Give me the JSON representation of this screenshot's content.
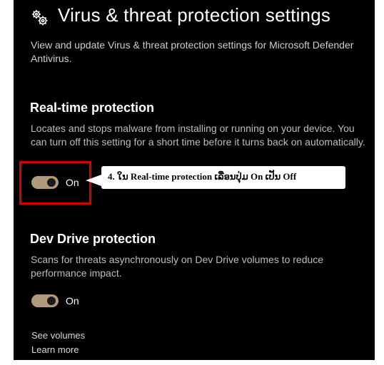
{
  "header": {
    "title": "Virus & threat protection settings",
    "description": "View and update Virus & threat protection settings for Microsoft Defender Antivirus."
  },
  "realtime": {
    "heading": "Real-time protection",
    "description": "Locates and stops malware from installing or running on your device. You can turn off this setting for a short time before it turns back on automatically.",
    "toggle_state": "On",
    "toggle_on": true
  },
  "devdrive": {
    "heading": "Dev Drive protection",
    "description": "Scans for threats asynchronously on Dev Drive volumes to reduce performance impact.",
    "toggle_state": "On",
    "toggle_on": true
  },
  "links": {
    "see_volumes": "See volumes",
    "learn_more": "Learn more"
  },
  "annotation": {
    "callout_text": "4. ໃນ Real-time protection ເລື່ອນປຸ່ມ On ເປັນ Off",
    "highlight_color": "#d40000"
  },
  "colors": {
    "toggle_track": "#b09a7c",
    "background": "#000000"
  },
  "icons": {
    "settings": "gear-icon"
  }
}
